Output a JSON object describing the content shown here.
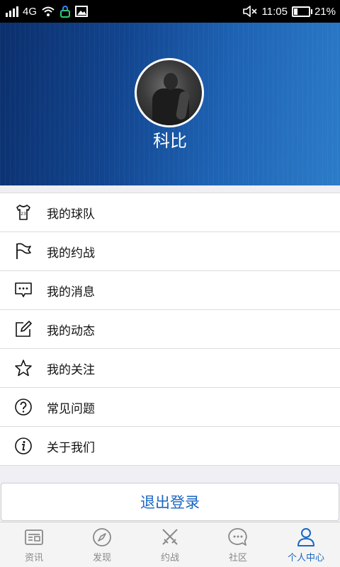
{
  "status_bar": {
    "network": "4G",
    "time": "11:05",
    "battery_text": "21%",
    "battery_level": 0.21
  },
  "profile": {
    "username": "科比"
  },
  "menu": {
    "items": [
      {
        "label": "我的球队",
        "icon": "jersey-icon"
      },
      {
        "label": "我的约战",
        "icon": "flag-icon"
      },
      {
        "label": "我的消息",
        "icon": "message-icon"
      },
      {
        "label": "我的动态",
        "icon": "edit-icon"
      },
      {
        "label": "我的关注",
        "icon": "star-icon"
      },
      {
        "label": "常见问题",
        "icon": "question-icon"
      },
      {
        "label": "关于我们",
        "icon": "info-icon"
      }
    ]
  },
  "logout_label": "退出登录",
  "tabbar": {
    "tabs": [
      {
        "label": "资讯",
        "icon": "news-icon"
      },
      {
        "label": "发现",
        "icon": "compass-icon"
      },
      {
        "label": "约战",
        "icon": "swords-icon"
      },
      {
        "label": "社区",
        "icon": "chat-icon"
      },
      {
        "label": "个人中心",
        "icon": "person-icon"
      }
    ],
    "active_index": 4
  },
  "colors": {
    "accent": "#1a66c2",
    "header_dark": "#0b2f6c",
    "header_light": "#2c7cc9"
  }
}
